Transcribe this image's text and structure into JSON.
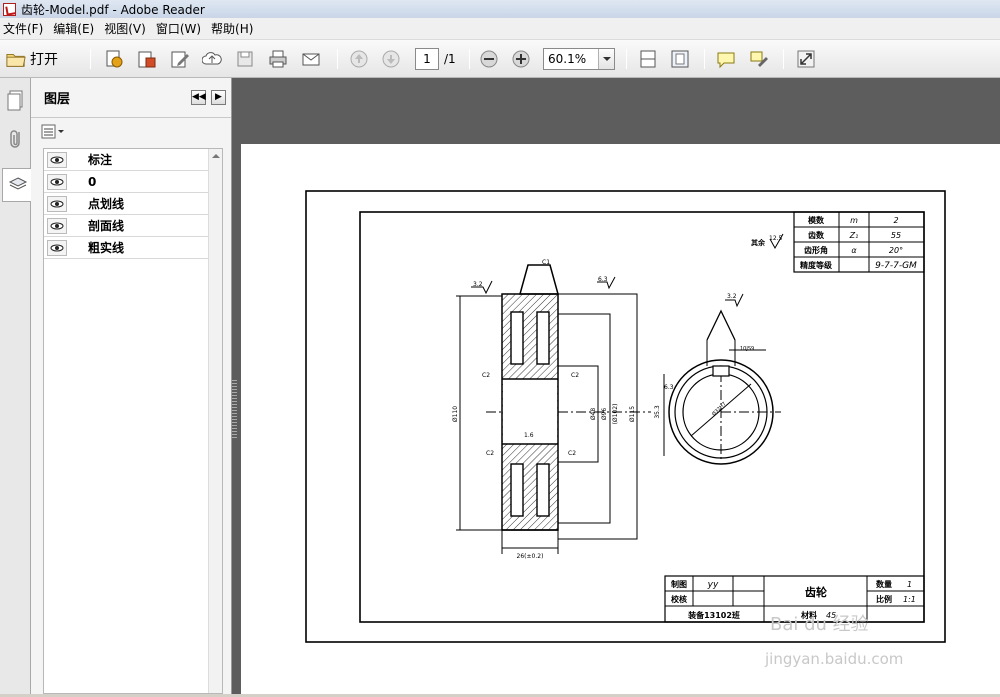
{
  "window": {
    "title": "齿轮-Model.pdf - Adobe Reader"
  },
  "menu": [
    "文件(F)",
    "编辑(E)",
    "视图(V)",
    "窗口(W)",
    "帮助(H)"
  ],
  "toolbar": {
    "open_label": "打开",
    "page_current": "1",
    "page_total": "/1",
    "zoom_value": "60.1%"
  },
  "panel": {
    "title": "图层",
    "layers": [
      "标注",
      "0",
      "点划线",
      "剖面线",
      "粗实线"
    ]
  },
  "drawing": {
    "params": [
      [
        "模数",
        "m",
        "2"
      ],
      [
        "齿数",
        "Z₁",
        "55"
      ],
      [
        "齿形角",
        "α",
        "20°"
      ],
      [
        "精度等级",
        "",
        "9-7-7-GM"
      ]
    ],
    "roughness_other": "12.5",
    "title_block": {
      "drawn_label": "制图",
      "drawn_value": "yy",
      "check_label": "校核",
      "part_name": "齿轮",
      "qty_label": "数量",
      "qty_value": "1",
      "scale_label": "比例",
      "scale_value": "1:1",
      "class_label": "装备13102班",
      "material_label": "材料",
      "material_value": "45"
    },
    "dims": {
      "chamfer_top": "C1",
      "r_left": "3.2",
      "r_right": "6.3",
      "c2_a": "C2",
      "c2_b": "C2",
      "c2_c": "C2",
      "c2_d": "C2",
      "r_mid": "1.6",
      "d_overall": "Ø110",
      "d_root": "Ø48",
      "d_hub": "Ø96",
      "d_pitch": "(Ø102)",
      "d_out": "Ø115",
      "width": "26(±0.2)",
      "key_r": "3.2",
      "key_w": "10JS9",
      "key_d": "35.3",
      "bore": "Ø32H7",
      "r_bore": "6.3"
    }
  },
  "watermark": {
    "line1": "Bai du 经验",
    "line2": "jingyan.baidu.com"
  }
}
